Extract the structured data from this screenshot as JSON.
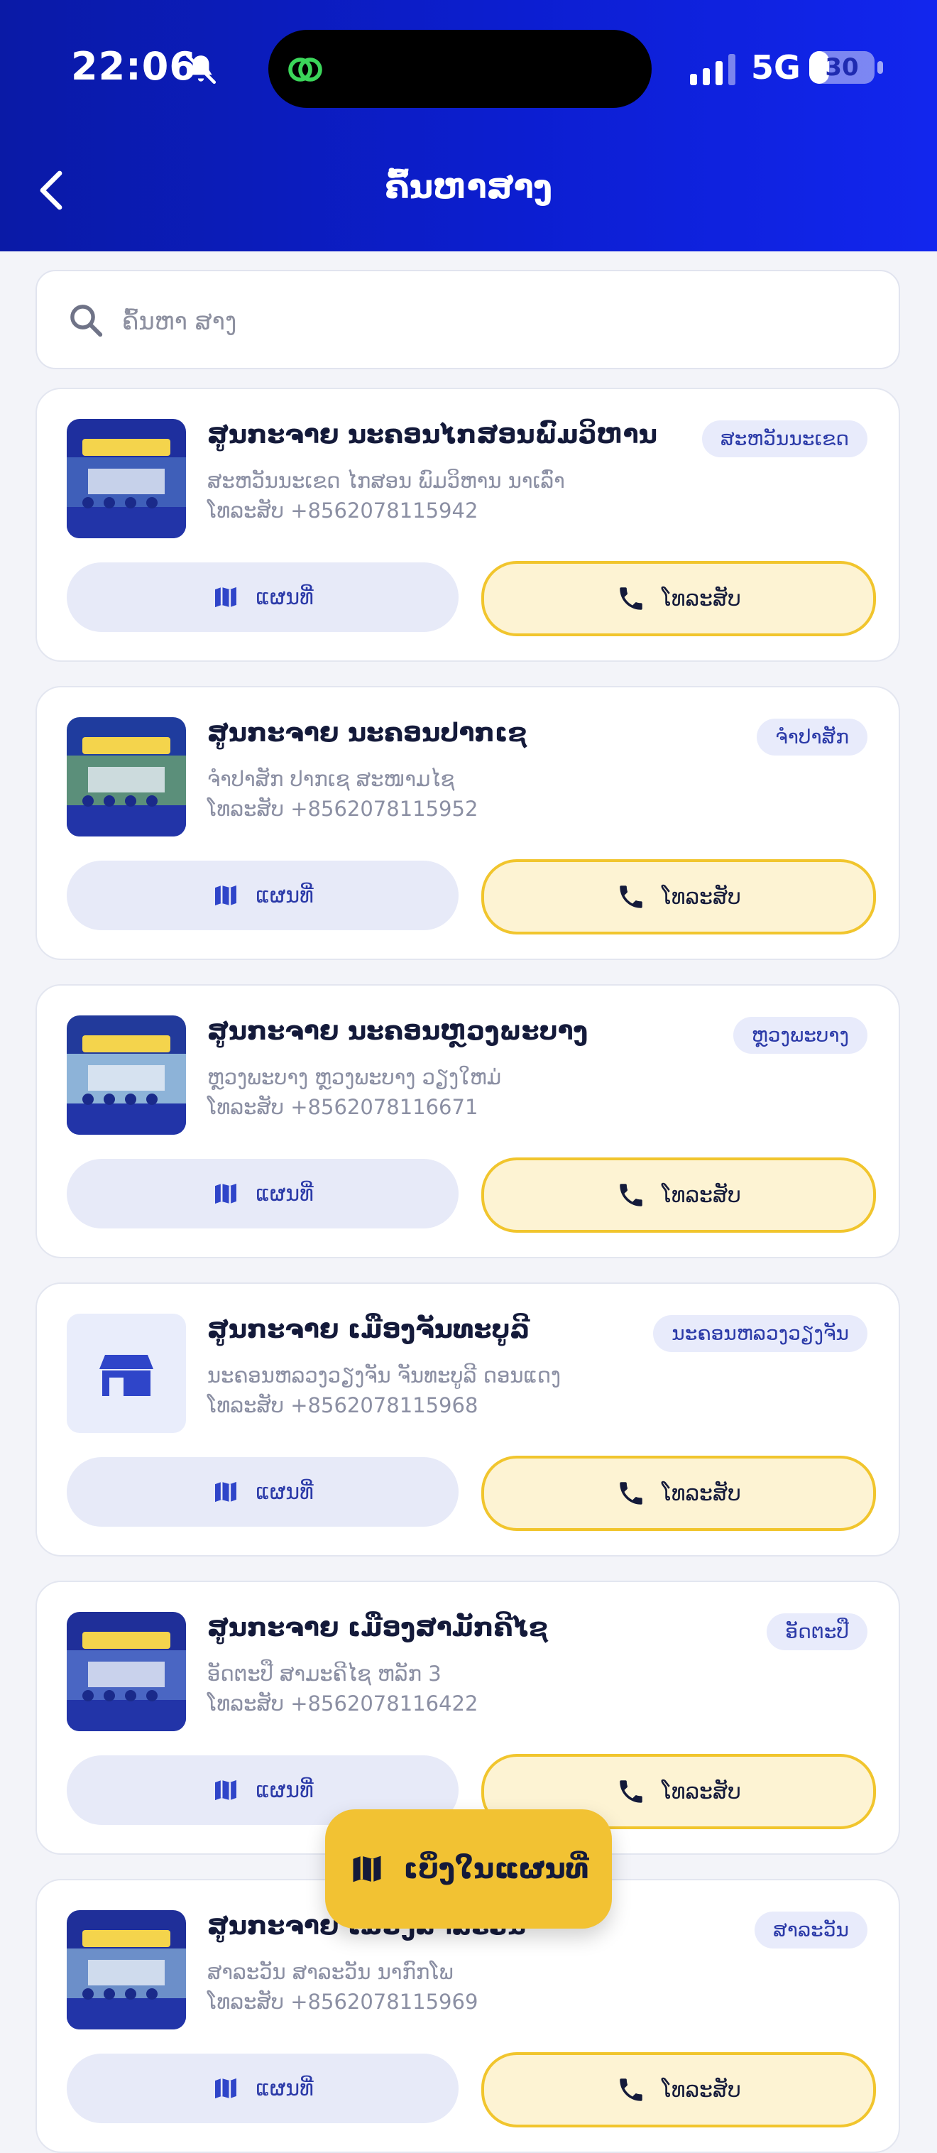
{
  "status_bar": {
    "time": "22:06",
    "network": "5G",
    "battery": 30
  },
  "header": {
    "title": "ຄົ້ນຫາສາງ"
  },
  "search": {
    "placeholder": "ຄົ້ນຫາ ສາງ"
  },
  "labels": {
    "map_button": "ແຜນທີ່",
    "call_button": "ໂທລະສັບ"
  },
  "cards": [
    {
      "name": "ສູນກະຈາຍ ນະຄອນໄກສອນພົມວິຫານ",
      "badge": "ສະຫວັນນະເຂດ",
      "address": "ສະຫວັນນະເຂດ ໄກສອນ ພົມວິຫານ ນາເລົ່າ",
      "phone": "ໂທລະສັບ +8562078115942"
    },
    {
      "name": "ສູນກະຈາຍ ນະຄອນປາກເຊ",
      "badge": "ຈຳປາສັກ",
      "address": "ຈຳປາສັກ ປາກເຊ ສະໜາມໄຊ",
      "phone": "ໂທລະສັບ +8562078115952"
    },
    {
      "name": "ສູນກະຈາຍ ນະຄອນຫຼວງພະບາງ",
      "badge": "ຫຼວງພະບາງ",
      "address": "ຫຼວງພະບາງ ຫຼວງພະບາງ ວຽງໃຫມ່",
      "phone": "ໂທລະສັບ +8562078116671"
    },
    {
      "name": "ສູນກະຈາຍ ເມືອງຈັນທະບູລີ",
      "badge": "ນະຄອນຫລວງວຽງຈັນ",
      "address": "ນະຄອນຫລວງວຽງຈັນ ຈັນທະບູລີ ດອນແດງ",
      "phone": "ໂທລະສັບ +8562078115968"
    },
    {
      "name": "ສູນກະຈາຍ ເມືອງສາມັກຄີໄຊ",
      "badge": "ອັດຕະປື",
      "address": "ອັດຕະປື ສາມະຄີໄຊ ຫລັກ 3",
      "phone": "ໂທລະສັບ +8562078116422"
    },
    {
      "name": "ສູນກະຈາຍ ເມືອງສາລະວັນ",
      "badge": "ສາລະວັນ",
      "address": "ສາລະວັນ ສາລະວັນ ນາກົກໂພ",
      "phone": "ໂທລະສັບ +8562078115969"
    }
  ],
  "fab": {
    "label": "ເບິ່ງໃນແຜນທີ່"
  },
  "colors": {
    "header_start": "#0a1aa6",
    "header_end": "#1226ee",
    "accent_yellow": "#f2c233",
    "badge_bg": "#e8ebfb",
    "badge_text": "#2b3aa8"
  },
  "icons": {
    "back": "chevron-left-icon",
    "search": "search-icon",
    "map": "map-icon",
    "call": "phone-icon",
    "store": "store-icon"
  }
}
